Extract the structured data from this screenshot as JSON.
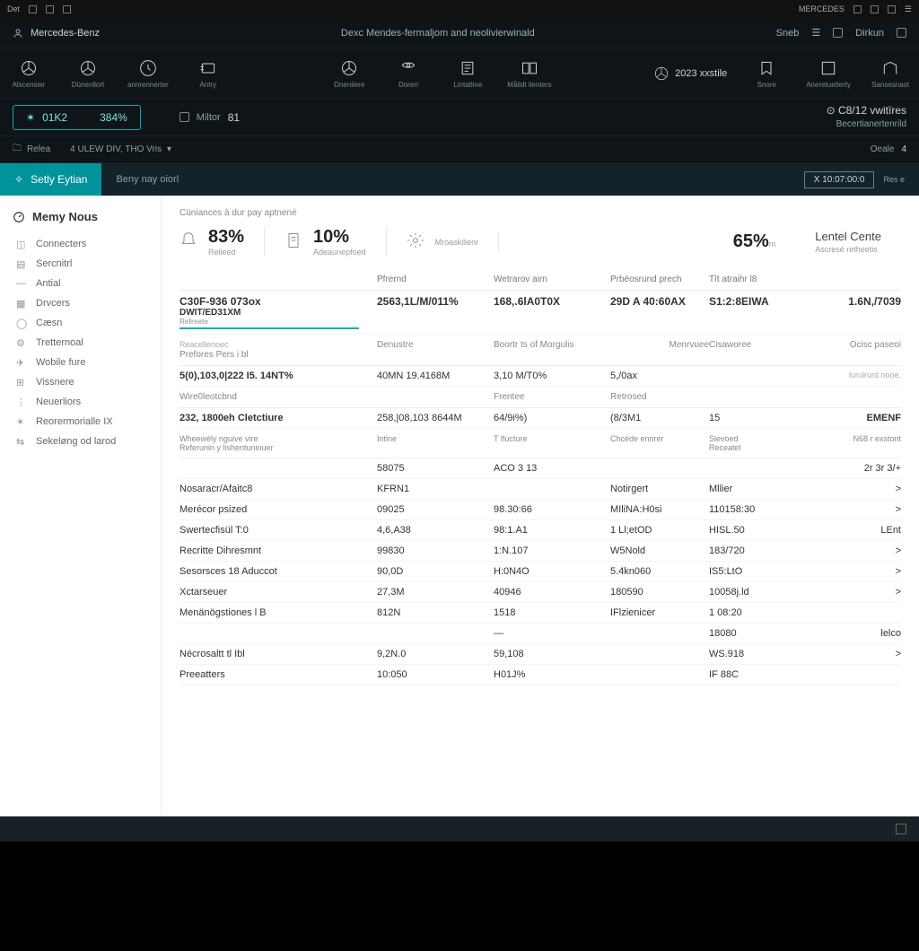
{
  "winbar": {
    "left": "Det",
    "brand": "MERCEDES",
    "menu": "☰"
  },
  "titlebar": {
    "left_icon": "person",
    "app": "Mercedes-Benz",
    "center": "Dexc Mendes-fermaljom and neolivierwinald",
    "search": "Sneb",
    "right": "Dirkun"
  },
  "apps": [
    {
      "name": "Alscensier"
    },
    {
      "name": "Dünenllort"
    },
    {
      "name": "annrennerter"
    },
    {
      "name": "Antry",
      "text": true
    },
    {
      "name": "Dnenilere"
    },
    {
      "name": "Dorerr"
    },
    {
      "name": "Lintatline"
    },
    {
      "name": "Måildt ilenters"
    }
  ],
  "apps_right": [
    {
      "name": "Snore"
    },
    {
      "name": "Aneretuetlerty"
    },
    {
      "name": "Sansesnast"
    }
  ],
  "year": "2023 xxstile",
  "metrics": {
    "chip1_a": "01K2",
    "chip1_b": "384%",
    "chip2_label": "Miltor",
    "chip2_val": "81"
  },
  "rightinfo": {
    "code": "C8/12 vwitïres",
    "sub": "Becertianertenrild"
  },
  "tabs": {
    "t1": "Relea",
    "t2": "4  ULEW DIV, THO Vris",
    "rt_label": "Oeale",
    "rt_count": "4"
  },
  "section": {
    "active": "Setly Eytian",
    "rest": "Beny nay oiorl",
    "btn": "X 10:07:00:0",
    "btn2": "Res e"
  },
  "side_title": "Memy Nous",
  "side_items": [
    "Connecters",
    "Sercnitrl",
    "Antial",
    "Drvcers",
    "Cæsn",
    "Tretternoal",
    "Wobile fure",
    "Vissnere",
    "Neuerliors",
    "Reorermorialle IX",
    "Sekeløng od larod"
  ],
  "crumb": "Cüniances à dur pay aptnené",
  "kpis": [
    {
      "val": "83%",
      "lbl": "Relieed"
    },
    {
      "val": "10%",
      "lbl": "Adeaunepfoed",
      "icon": "doc"
    },
    {
      "val": "",
      "lbl": "Mroaskilienr",
      "icon": "gear"
    },
    {
      "val": "65%",
      "lbl": "m"
    },
    {
      "val": "Lentel Cente",
      "lbl": "Ascresé retheetis",
      "head": true
    }
  ],
  "summary_hdr": [
    "",
    "Pfrernd",
    "Wetrarov airn",
    "Prbéosrund prech",
    "Tît atraihr l8",
    ""
  ],
  "summary_row": {
    "c1a": "C30F-936 073ox",
    "c1b": "DWIT/ED31XM",
    "c2": "2563,1L/M/011% ",
    "c3": "168,.6lA0T0X",
    "c4": "29D A 40:60AX",
    "c5": "S1:2:8EIWA",
    "c6": "1.6N,/7039"
  },
  "hdr2": [
    "Prefores Pers i bl",
    "Denustre",
    "Boortr ts of Morgulis",
    "Menrvuee",
    "Cisaworee",
    "Ocisc paseoi"
  ],
  "row2": {
    "c1": "5(0),103,0|222 I5.  14NT%",
    "c2": "40MN   19.4168M",
    "c3": "3,10   M/T0%",
    "c4": "5,/0ax",
    "c6": "lurulrurd nooe,"
  },
  "hdr3": [
    "Wire0leotcbnd",
    "",
    "Frentee",
    "Retrosed",
    "",
    ""
  ],
  "row3": {
    "c1": "232, 1800eh Cletctiure",
    "c2": "258,|08,103   8644M",
    "c3": "64/9i%)",
    "c4": "(8/3M1",
    "c5": "15",
    "c6": "EMENF"
  },
  "sub_labels": {
    "a": "Wheewély nguive vire",
    "b": "Referunin y lishentuninuer",
    "h2": "Intine",
    "h3": "T flucture",
    "h4": "Chcède ennrer",
    "h5a": "Slevoed",
    "h5b": "Receatel",
    "h6": "N68 r exstont"
  },
  "table": [
    {
      "n": "",
      "a": "58075",
      "b": "ACO 3 13",
      "c": "",
      "d": "",
      "e": "2r 3r 3/+"
    },
    {
      "n": "Nosaracr/Afaitc8",
      "a": "KFRN1",
      "b": "",
      "c": "Notirgert",
      "d": "Mllier",
      "e": ">"
    },
    {
      "n": "Merécor psized",
      "a": "09025",
      "b": "98.30:66",
      "c": "MIliNA:H0si",
      "d": "110158:30",
      "e": ">"
    },
    {
      "n": "Swertecfisül T:0",
      "a": "4,6,A38",
      "b": "98:1.A1",
      "c": "1 Ll;etOD",
      "d": "HISL.50",
      "e": "LEnt"
    },
    {
      "n": "Recritte Dihresmnt",
      "a": "99830",
      "b": "1:N.107",
      "c": "W5Nold",
      "d": "183/720",
      "e": ">"
    },
    {
      "n": "Sesorsces 18 Aduccot",
      "a": "90,0D",
      "b": "H:0N4O",
      "c": "5.4kn060",
      "d": "IS5:LtO",
      "e": ">"
    },
    {
      "n": "Xctarseuer",
      "a": "27,3M",
      "b": "40946",
      "c": "180590",
      "d": "10058j.ld",
      "e": ">"
    },
    {
      "n": "Menänögstiones l B",
      "a": "812N",
      "b": "1518",
      "c": "IFlzienicer",
      "d": "1 08:20",
      "e": ""
    },
    {
      "n": "",
      "a": "",
      "b": "—",
      "c": "",
      "d": "18080",
      "e": "lelco"
    },
    {
      "n": "Nécrosaltt tl Ibl",
      "a": "9,2N.0",
      "b": "59,108",
      "c": "",
      "d": "WS.918",
      "e": ">"
    },
    {
      "n": "Preeatters",
      "a": "10:050",
      "b": "H01J%",
      "c": "",
      "d": "IF 88C",
      "e": ""
    }
  ]
}
